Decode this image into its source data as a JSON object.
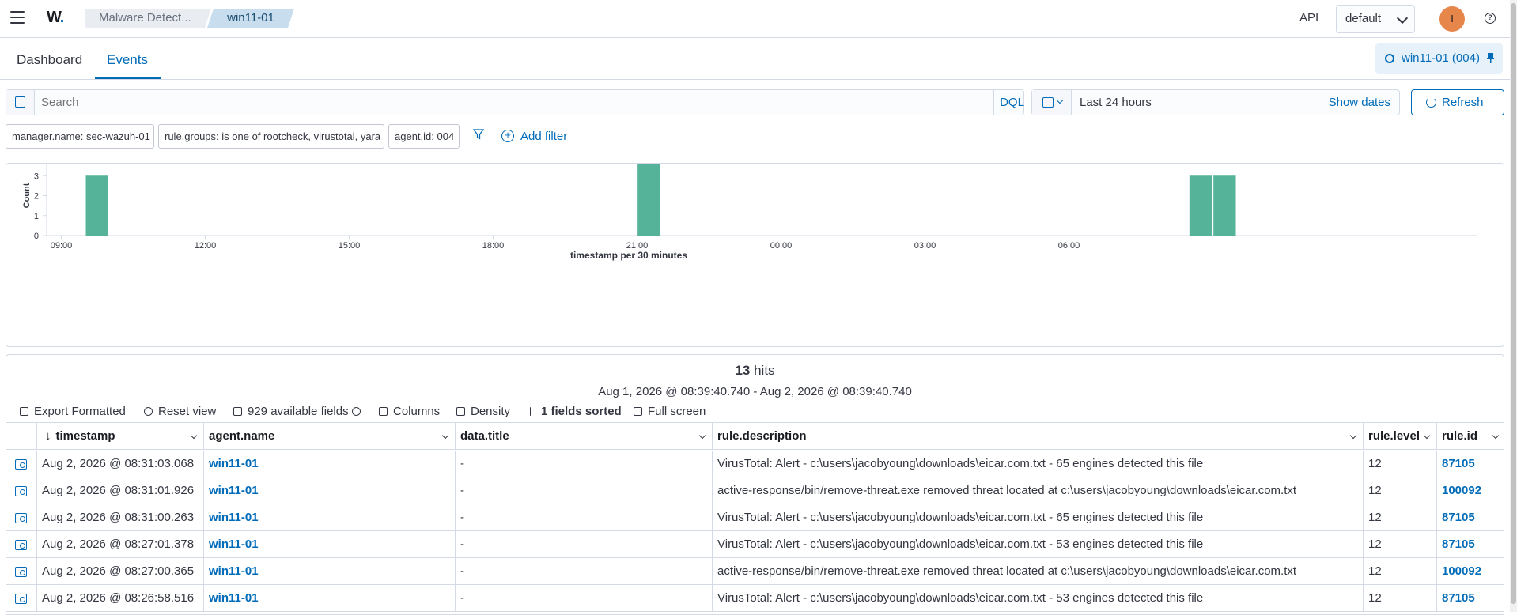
{
  "header": {
    "logo": "W",
    "logo_dot": ".",
    "breadcrumbs": [
      "Malware Detect...",
      "win11-01"
    ],
    "api_label": "API",
    "tenant": "default",
    "avatar_initial": "I",
    "help_glyph": "?"
  },
  "tabs": [
    {
      "label": "Dashboard",
      "active": false
    },
    {
      "label": "Events",
      "active": true
    }
  ],
  "agent_pill": "win11-01 (004)",
  "search": {
    "placeholder": "Search",
    "language": "DQL"
  },
  "datepicker": {
    "range": "Last 24 hours",
    "show_dates": "Show dates",
    "refresh": "Refresh"
  },
  "filters": [
    "manager.name: sec-wazuh-01",
    "rule.groups: is one of rootcheck, virustotal, yara",
    "agent.id: 004"
  ],
  "add_filter": "Add filter",
  "chart_data": {
    "type": "bar",
    "ylabel": "Count",
    "xlabel": "timestamp per 30 minutes",
    "ylim": [
      0,
      4
    ],
    "yticks": [
      "0",
      "1",
      "2",
      "3",
      "4"
    ],
    "xticks": [
      "09:00",
      "12:00",
      "15:00",
      "18:00",
      "21:00",
      "00:00",
      "03:00",
      "06:00"
    ],
    "x_start_hour": 8.5,
    "bars": [
      {
        "start_hour": 9.0,
        "value": 3
      },
      {
        "start_hour": 20.5,
        "value": 4
      },
      {
        "start_hour": 32.0,
        "value": 3
      },
      {
        "start_hour": 32.5,
        "value": 3
      }
    ],
    "partial_bucket_start_hour": 33.0,
    "color": "#54b399",
    "grid": false,
    "legend": "none"
  },
  "results": {
    "hits_count": "13",
    "hits_label": "hits",
    "range": "Aug 1, 2026 @ 08:39:40.740 - Aug 2, 2026 @ 08:39:40.740",
    "toolbar": {
      "export": "Export Formatted",
      "reset": "Reset view",
      "fields": "929 available fields",
      "columns": "Columns",
      "density": "Density",
      "sorted": "1 fields sorted",
      "fullscreen": "Full screen"
    },
    "columns": [
      "timestamp",
      "agent.name",
      "data.title",
      "rule.description",
      "rule.level",
      "rule.id"
    ],
    "rows": [
      {
        "timestamp": "Aug 2, 2026 @ 08:31:03.068",
        "agent": "win11-01",
        "title": "-",
        "description": "VirusTotal: Alert - c:\\users\\jacobyoung\\downloads\\eicar.com.txt - 65 engines detected this file",
        "level": "12",
        "id": "87105"
      },
      {
        "timestamp": "Aug 2, 2026 @ 08:31:01.926",
        "agent": "win11-01",
        "title": "-",
        "description": "active-response/bin/remove-threat.exe removed threat located at c:\\users\\jacobyoung\\downloads\\eicar.com.txt",
        "level": "12",
        "id": "100092"
      },
      {
        "timestamp": "Aug 2, 2026 @ 08:31:00.263",
        "agent": "win11-01",
        "title": "-",
        "description": "VirusTotal: Alert - c:\\users\\jacobyoung\\downloads\\eicar.com.txt - 65 engines detected this file",
        "level": "12",
        "id": "87105"
      },
      {
        "timestamp": "Aug 2, 2026 @ 08:27:01.378",
        "agent": "win11-01",
        "title": "-",
        "description": "VirusTotal: Alert - c:\\users\\jacobyoung\\downloads\\eicar.com.txt - 53 engines detected this file",
        "level": "12",
        "id": "87105"
      },
      {
        "timestamp": "Aug 2, 2026 @ 08:27:00.365",
        "agent": "win11-01",
        "title": "-",
        "description": "active-response/bin/remove-threat.exe removed threat located at c:\\users\\jacobyoung\\downloads\\eicar.com.txt",
        "level": "12",
        "id": "100092"
      },
      {
        "timestamp": "Aug 2, 2026 @ 08:26:58.516",
        "agent": "win11-01",
        "title": "-",
        "description": "VirusTotal: Alert - c:\\users\\jacobyoung\\downloads\\eicar.com.txt - 53 engines detected this file",
        "level": "12",
        "id": "87105"
      }
    ]
  }
}
